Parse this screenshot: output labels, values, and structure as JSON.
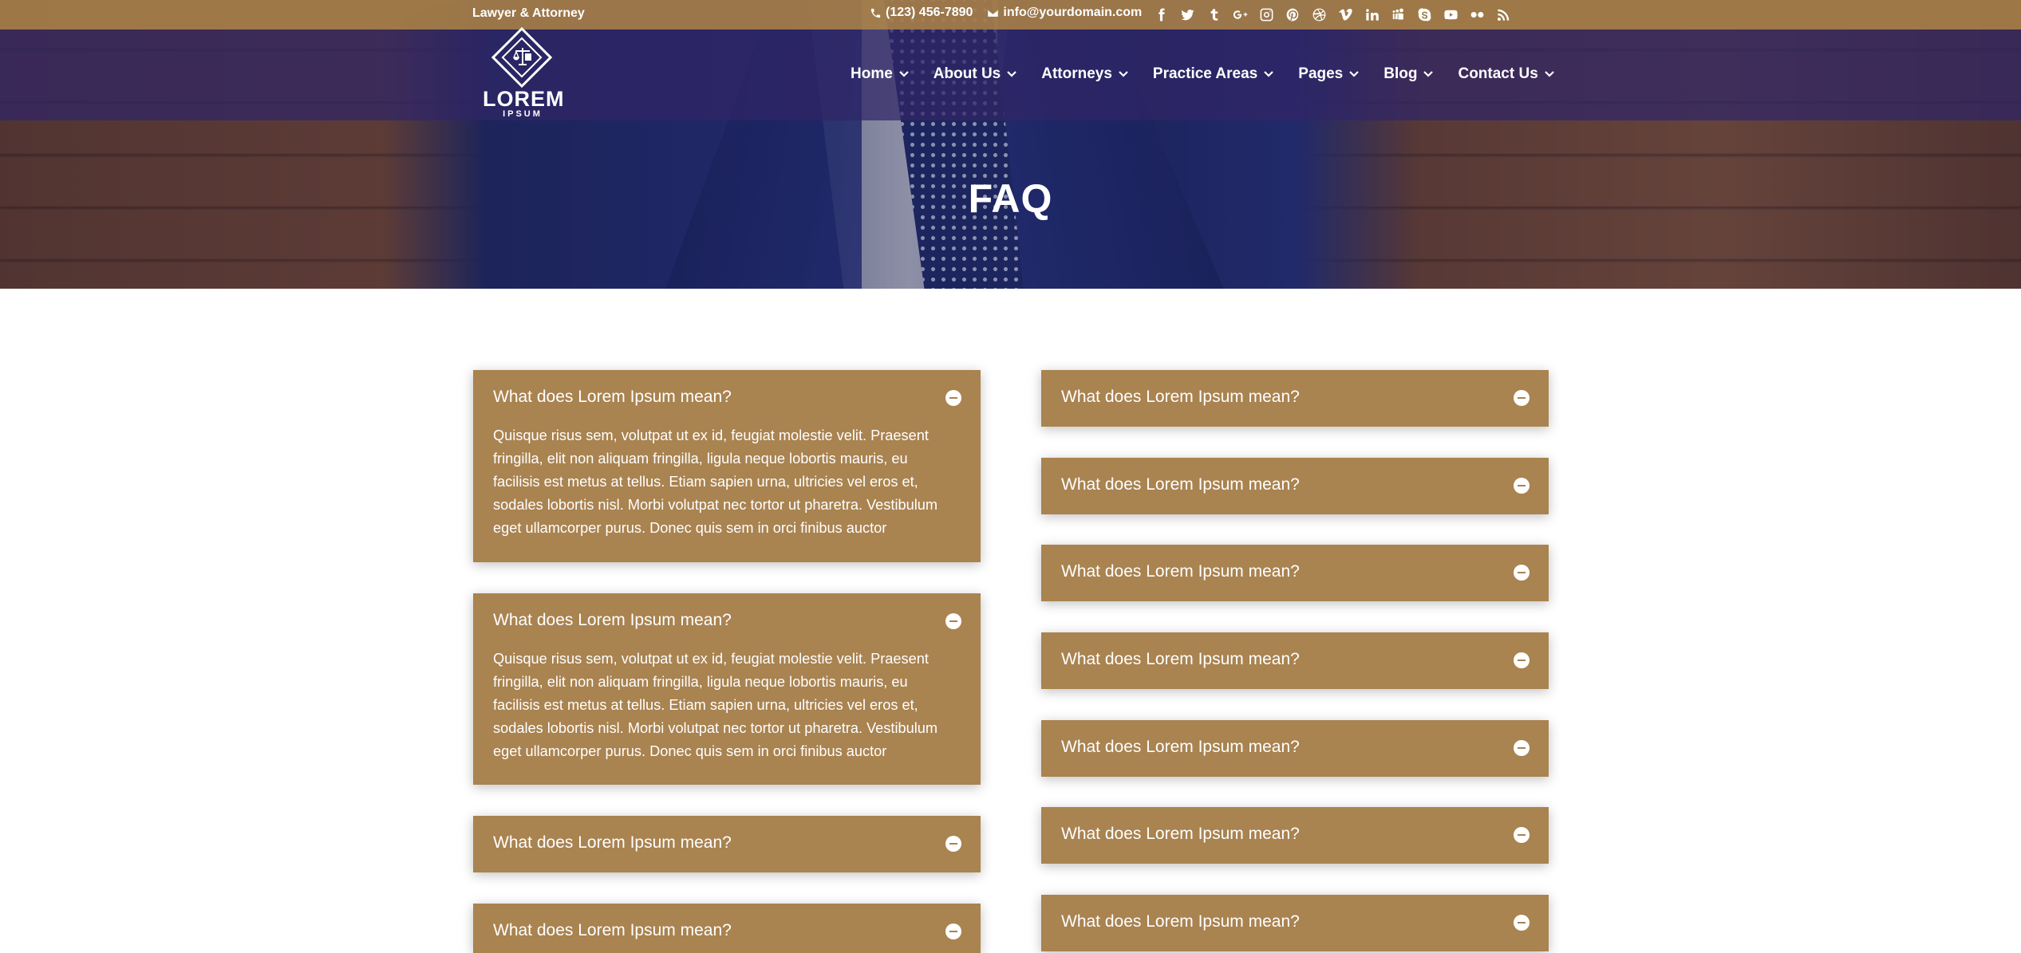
{
  "topbar": {
    "tagline": "Lawyer & Attorney",
    "phone": "(123) 456-7890",
    "email": "info@yourdomain.com",
    "social_icons": [
      "facebook-icon",
      "twitter-icon",
      "tumblr-icon",
      "google-plus-icon",
      "instagram-icon",
      "pinterest-icon",
      "dribbble-icon",
      "vimeo-icon",
      "linkedin-icon",
      "myspace-icon",
      "skype-icon",
      "youtube-icon",
      "flickr-icon",
      "rss-icon"
    ]
  },
  "logo": {
    "word": "LOREM",
    "sub": "IPSUM"
  },
  "nav": {
    "items": [
      {
        "label": "Home"
      },
      {
        "label": "About Us"
      },
      {
        "label": "Attorneys"
      },
      {
        "label": "Practice Areas"
      },
      {
        "label": "Pages"
      },
      {
        "label": "Blog"
      },
      {
        "label": "Contact Us"
      }
    ]
  },
  "hero": {
    "title": "FAQ"
  },
  "faq": {
    "left": [
      {
        "question": "What does Lorem Ipsum mean?",
        "answer": "Quisque risus sem, volutpat ut ex id, feugiat molestie velit. Praesent fringilla, elit non aliquam fringilla, ligula neque lobortis mauris, eu facilisis est metus at tellus. Etiam sapien urna, ultricies vel eros et, sodales lobortis nisl. Morbi volutpat nec tortor ut pharetra. Vestibulum eget ullamcorper purus. Donec quis sem in orci finibus auctor"
      },
      {
        "question": "What does Lorem Ipsum mean?",
        "answer": "Quisque risus sem, volutpat ut ex id, feugiat molestie velit. Praesent fringilla, elit non aliquam fringilla, ligula neque lobortis mauris, eu facilisis est metus at tellus. Etiam sapien urna, ultricies vel eros et, sodales lobortis nisl. Morbi volutpat nec tortor ut pharetra. Vestibulum eget ullamcorper purus. Donec quis sem in orci finibus auctor"
      },
      {
        "question": "What does Lorem Ipsum mean?"
      },
      {
        "question": "What does Lorem Ipsum mean?"
      }
    ],
    "right": [
      {
        "question": "What does Lorem Ipsum mean?"
      },
      {
        "question": "What does Lorem Ipsum mean?"
      },
      {
        "question": "What does Lorem Ipsum mean?"
      },
      {
        "question": "What does Lorem Ipsum mean?"
      },
      {
        "question": "What does Lorem Ipsum mean?"
      },
      {
        "question": "What does Lorem Ipsum mean?"
      },
      {
        "question": "What does Lorem Ipsum mean?"
      }
    ]
  },
  "colors": {
    "accent": "#a98350",
    "topbar": "#a47d48",
    "nav_overlay": "#302666"
  }
}
